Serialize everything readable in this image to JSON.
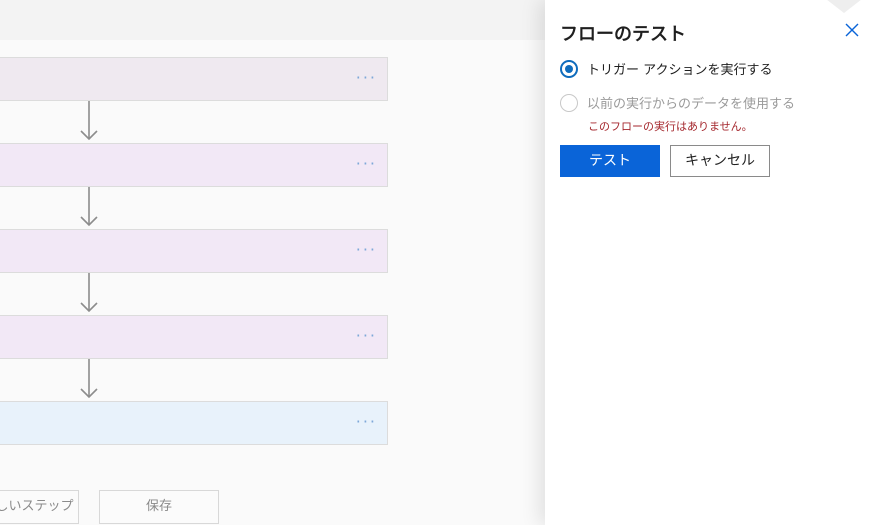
{
  "panel": {
    "title": "フローのテスト",
    "options": [
      {
        "label": "トリガー アクションを実行する",
        "selected": true,
        "enabled": true
      },
      {
        "label": "以前の実行からのデータを使用する",
        "selected": false,
        "enabled": false
      }
    ],
    "no_runs_message": "このフローの実行はありません。",
    "test_button": "テスト",
    "cancel_button": "キャンセル",
    "close_icon": "close-icon"
  },
  "canvas": {
    "steps": [
      {
        "menu": "···",
        "color": "#efe9f0"
      },
      {
        "menu": "···",
        "color": "#f2e8f6"
      },
      {
        "menu": "···",
        "color": "#f2e8f6"
      },
      {
        "menu": "···",
        "color": "#f2e8f6"
      },
      {
        "menu": "···",
        "color": "#e8f2fb"
      }
    ],
    "new_step_button": "しいステップ",
    "save_button": "保存"
  },
  "colors": {
    "accent": "#0a64d8",
    "warning": "#a4262c"
  }
}
